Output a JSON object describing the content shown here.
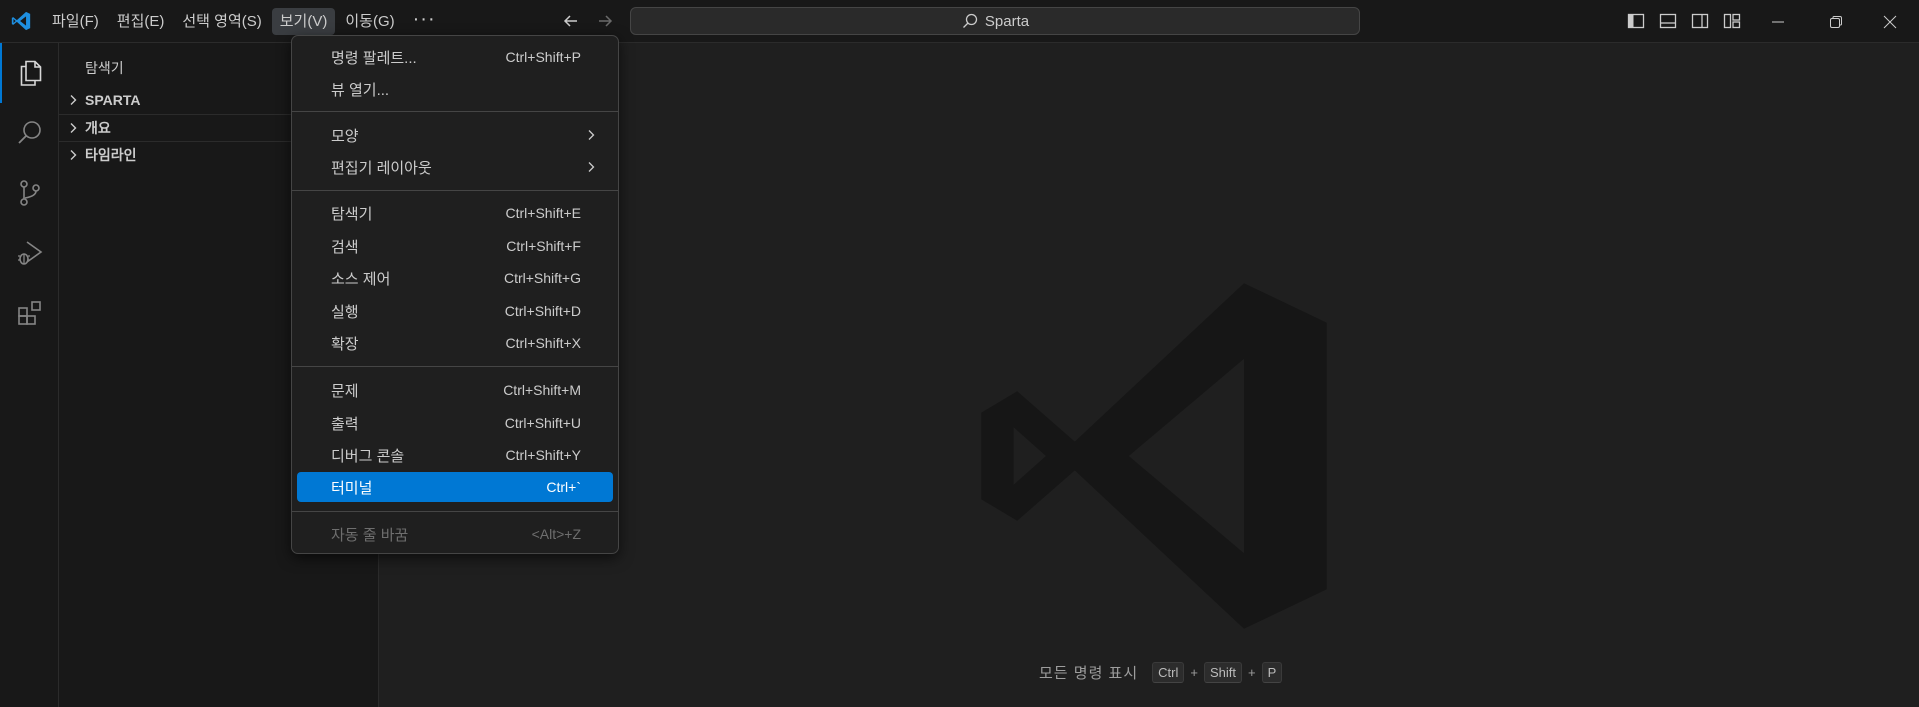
{
  "menubar": {
    "items": [
      "파일(F)",
      "편집(E)",
      "선택 영역(S)",
      "보기(V)",
      "이동(G)"
    ],
    "more": "···"
  },
  "search": {
    "text": "Sparta"
  },
  "sidebar": {
    "title": "탐색기",
    "sections": [
      "SPARTA",
      "개요",
      "타임라인"
    ]
  },
  "view_menu": {
    "group1": [
      {
        "label": "명령 팔레트...",
        "shortcut": "Ctrl+Shift+P"
      },
      {
        "label": "뷰 열기..."
      }
    ],
    "group2": [
      {
        "label": "모양"
      },
      {
        "label": "편집기 레이아웃"
      }
    ],
    "group3": [
      {
        "label": "탐색기",
        "shortcut": "Ctrl+Shift+E"
      },
      {
        "label": "검색",
        "shortcut": "Ctrl+Shift+F"
      },
      {
        "label": "소스 제어",
        "shortcut": "Ctrl+Shift+G"
      },
      {
        "label": "실행",
        "shortcut": "Ctrl+Shift+D"
      },
      {
        "label": "확장",
        "shortcut": "Ctrl+Shift+X"
      }
    ],
    "group4": [
      {
        "label": "문제",
        "shortcut": "Ctrl+Shift+M"
      },
      {
        "label": "출력",
        "shortcut": "Ctrl+Shift+U"
      },
      {
        "label": "디버그 콘솔",
        "shortcut": "Ctrl+Shift+Y"
      },
      {
        "label": "터미널",
        "shortcut": "Ctrl+`"
      }
    ],
    "group5": [
      {
        "label": "자동 줄 바꿈",
        "shortcut": "<Alt>+Z"
      }
    ]
  },
  "editor": {
    "hint_label": "모든 명령 표시",
    "keys": [
      "Ctrl",
      "Shift",
      "P"
    ],
    "plus": "+"
  },
  "colors": {
    "accent": "#0078d4",
    "background": "#1f1f1f",
    "chrome": "#181818"
  },
  "icons": [
    "vscode-logo-icon",
    "explorer-icon",
    "search-icon",
    "source-control-icon",
    "run-debug-icon",
    "extensions-icon"
  ]
}
